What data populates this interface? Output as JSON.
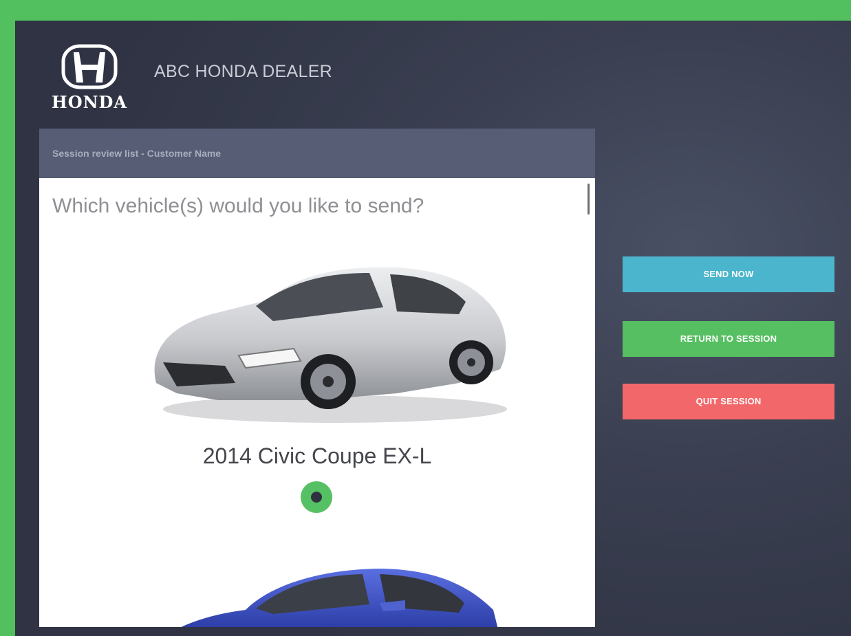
{
  "brand": {
    "logo_text": "HONDA",
    "dealer_name": "ABC HONDA DEALER"
  },
  "panel": {
    "header": "Session review list - Customer Name",
    "question": "Which vehicle(s) would you like to send?",
    "vehicles": [
      {
        "name": "2014 Civic Coupe EX-L",
        "color": "#c8cace",
        "selected": true
      },
      {
        "name": "",
        "color": "#2e3fa8",
        "selected": false
      }
    ]
  },
  "actions": {
    "send_now": "SEND NOW",
    "return_to_session": "RETURN TO SESSION",
    "quit_session": "QUIT SESSION"
  },
  "colors": {
    "frame": "#52c05e",
    "send": "#4ab5cd",
    "return": "#55bf61",
    "quit": "#f2686a"
  }
}
